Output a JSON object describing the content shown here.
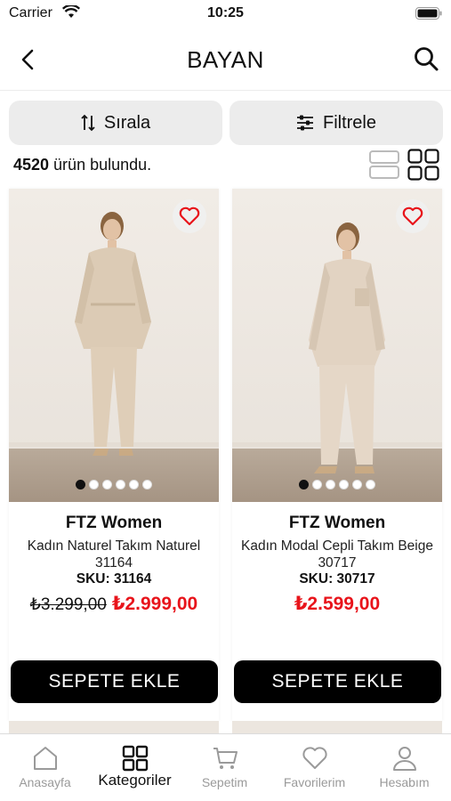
{
  "status_bar": {
    "carrier": "Carrier",
    "time": "10:25"
  },
  "nav": {
    "title": "BAYAN"
  },
  "filters": {
    "sort_label": "Sırala",
    "filter_label": "Filtrele"
  },
  "results": {
    "count": "4520",
    "suffix": " ürün bulundu."
  },
  "products": [
    {
      "brand": "FTZ Women",
      "name": "Kadın Naturel Takım Naturel 31164",
      "sku": "SKU: 31164",
      "old_price": "₺3.299,00",
      "price": "₺2.999,00",
      "add_to_cart": "SEPETE EKLE",
      "image_pages": 6,
      "current_page": 1
    },
    {
      "brand": "FTZ Women",
      "name": "Kadın Modal Cepli Takım Beige 30717",
      "sku": "SKU: 30717",
      "old_price": "",
      "price": "₺2.599,00",
      "add_to_cart": "SEPETE EKLE",
      "image_pages": 6,
      "current_page": 1
    }
  ],
  "tabbar": {
    "tabs": [
      {
        "label": "Anasayfa",
        "icon": "home-icon",
        "active": false
      },
      {
        "label": "Kategoriler",
        "icon": "grid-icon",
        "active": true
      },
      {
        "label": "Sepetim",
        "icon": "cart-icon",
        "active": false
      },
      {
        "label": "Favorilerim",
        "icon": "heart-icon",
        "active": false
      },
      {
        "label": "Hesabım",
        "icon": "person-icon",
        "active": false
      }
    ]
  },
  "colors": {
    "accent_price": "#e8141b",
    "button_bg": "#000000",
    "chip_bg": "#ececec"
  }
}
